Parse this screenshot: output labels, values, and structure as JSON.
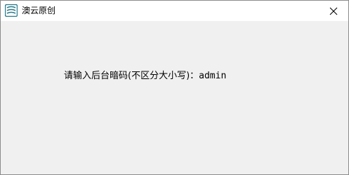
{
  "window": {
    "title": "澳云原创",
    "icon": "app-logo-icon",
    "close_icon": "close-icon"
  },
  "content": {
    "prompt_label": "请输入后台暗码(不区分大小写)：",
    "prompt_value": "admin"
  },
  "colors": {
    "titlebar_bg": "#ffffff",
    "client_bg": "#f0f0f0",
    "border": "#8b8b8b",
    "icon_accent": "#2a7c8c",
    "text": "#000000"
  }
}
